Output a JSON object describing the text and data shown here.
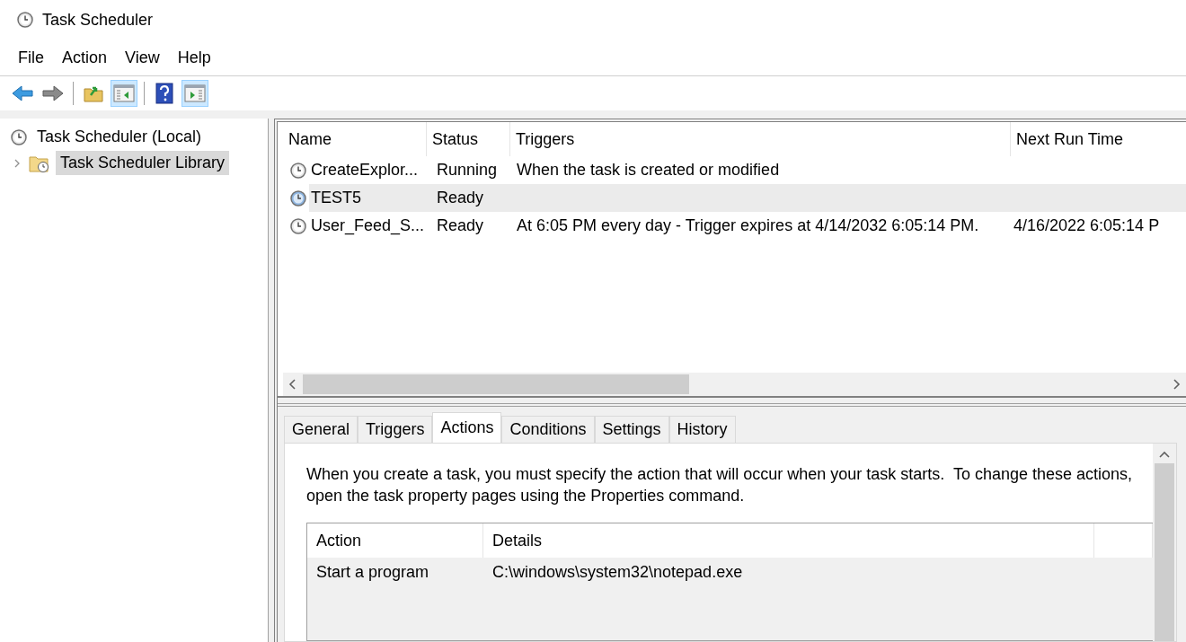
{
  "window": {
    "title": "Task Scheduler"
  },
  "menu": [
    "File",
    "Action",
    "View",
    "Help"
  ],
  "toolbar": [
    [
      {
        "kind": "back"
      },
      {
        "kind": "forward"
      }
    ],
    [
      {
        "kind": "up"
      },
      {
        "kind": "tree-pane",
        "on": true
      }
    ],
    [
      {
        "kind": "help"
      },
      {
        "kind": "action-pane",
        "on": true
      }
    ]
  ],
  "tree": [
    {
      "label": "Task Scheduler (Local)",
      "selected": false,
      "children": [
        {
          "label": "Task Scheduler Library",
          "selected": true,
          "expanded": false
        }
      ]
    }
  ],
  "tasks": {
    "columns": [
      "Name",
      "Status",
      "Triggers",
      "Next Run Time"
    ],
    "rows": [
      {
        "name": "CreateExplor...",
        "status": "Running",
        "triggers": "When the task is created or modified",
        "selected": false
      },
      {
        "name": "TEST5",
        "status": "Ready",
        "selected": true
      },
      {
        "name": "User_Feed_S...",
        "status": "Ready",
        "triggers": "At 6:05 PM every day - Trigger expires at 4/14/2032 6:05:14 PM.",
        "next_run": "4/16/2022 6:05:14 P",
        "selected": false
      }
    ]
  },
  "tabs": [
    {
      "label": "General",
      "selected": false
    },
    {
      "label": "Triggers",
      "selected": false
    },
    {
      "label": "Actions",
      "selected": true
    },
    {
      "label": "Conditions",
      "selected": false
    },
    {
      "label": "Settings",
      "selected": false
    },
    {
      "label": "History",
      "selected": false
    }
  ],
  "actions_description": "When you create a task, you must specify the action that will occur when your task starts.  To change these actions, open the task property pages using the Properties command.",
  "actions": {
    "columns": [
      "Action",
      "Details"
    ],
    "rows": [
      {
        "action": "Start a program",
        "details": "C:\\windows\\system32\\notepad.exe"
      }
    ]
  }
}
